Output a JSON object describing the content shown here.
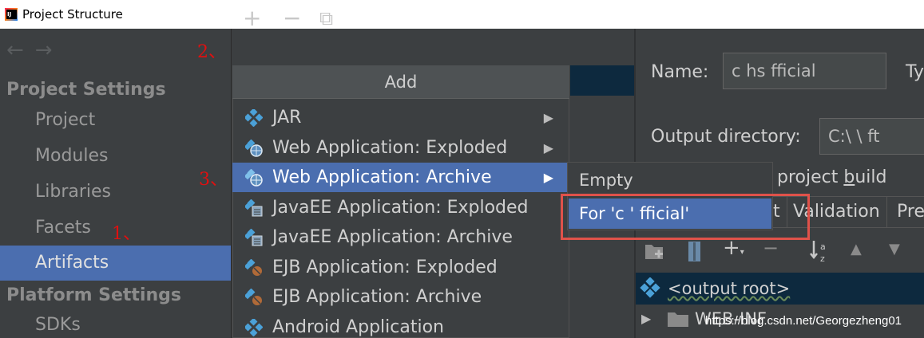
{
  "window": {
    "title": "Project Structure"
  },
  "nav": {
    "back": "←",
    "forward": "→"
  },
  "sidebar": {
    "project_settings_header": "Project Settings",
    "items": [
      {
        "label": "Project"
      },
      {
        "label": "Modules"
      },
      {
        "label": "Libraries"
      },
      {
        "label": "Facets"
      },
      {
        "label": "Artifacts",
        "selected": true
      }
    ],
    "platform_settings_header": "Platform Settings",
    "platform_items": [
      {
        "label": "SDKs"
      }
    ]
  },
  "toolbar": {
    "add": "+",
    "remove": "−",
    "copy": "⧉"
  },
  "add_menu": {
    "title": "Add",
    "items": [
      {
        "label": "JAR",
        "submenu": true
      },
      {
        "label": "Web Application: Exploded",
        "submenu": true
      },
      {
        "label": "Web Application: Archive",
        "submenu": true,
        "selected": true
      },
      {
        "label": "JavaEE Application: Exploded"
      },
      {
        "label": "JavaEE Application: Archive"
      },
      {
        "label": "EJB Application: Exploded"
      },
      {
        "label": "EJB Application: Archive"
      },
      {
        "label": "Android Application"
      }
    ],
    "submenu_arrow": "▶"
  },
  "submenu": {
    "items": [
      {
        "label": "Empty"
      },
      {
        "label": "For 'c    '    fficial'",
        "selected": true
      }
    ]
  },
  "details": {
    "name_label": "Name:",
    "name_value": "c    hs  fficial",
    "type_label": "Ty",
    "output_dir_label": "Output directory:",
    "output_dir_value": "C:\\     \\    ft",
    "build_label_prefix": "project ",
    "build_label_underlined": "b",
    "build_label_suffix": "uild",
    "tabs": [
      {
        "label": "t"
      },
      {
        "label": "Validation"
      },
      {
        "label": "Pre"
      }
    ],
    "tree": [
      {
        "label": "<output root>"
      },
      {
        "label": "WEB-INF"
      }
    ]
  },
  "annotations": {
    "one": "1、",
    "two": "2、",
    "three": "3、"
  },
  "watermark": "https://blog.csdn.net/Georgezheng01",
  "colors": {
    "selection": "#4b6eaf",
    "background": "#3c3f41",
    "highlight_box": "#e0524a",
    "tree_selection": "#0d293e"
  }
}
